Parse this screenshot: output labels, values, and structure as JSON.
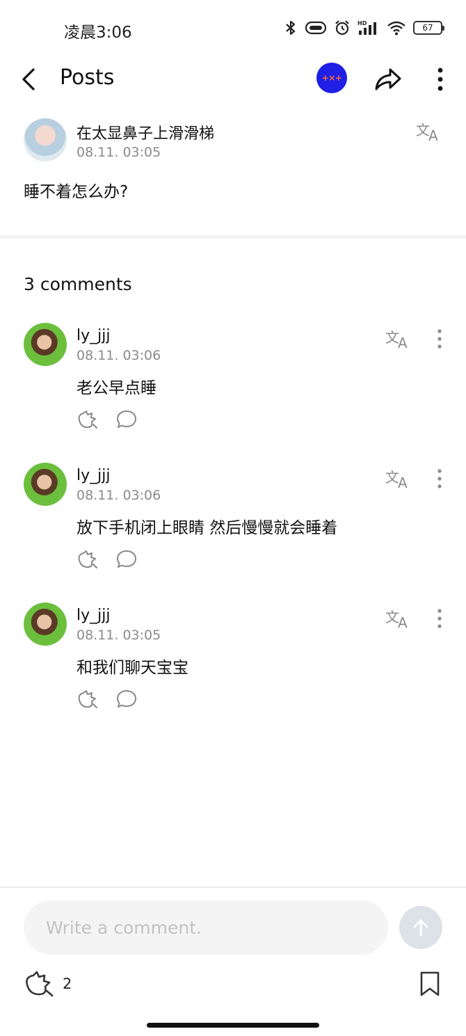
{
  "status_bar": {
    "time": "凌晨3:06",
    "battery": "67"
  },
  "header": {
    "title": "Posts",
    "badge_text": "+×+"
  },
  "post": {
    "author": "在太显鼻子上滑滑梯",
    "time": "08.11. 03:05",
    "body": "睡不着怎么办?"
  },
  "comments_section": {
    "count_label": "3 comments",
    "items": [
      {
        "author": "ly_jjj",
        "time": "08.11. 03:06",
        "text": "老公早点睡"
      },
      {
        "author": "ly_jjj",
        "time": "08.11. 03:06",
        "text": "放下手机闭上眼睛 然后慢慢就会睡着"
      },
      {
        "author": "ly_jjj",
        "time": "08.11. 03:05",
        "text": "和我们聊天宝宝"
      }
    ]
  },
  "composer": {
    "placeholder": "Write a comment."
  },
  "footer": {
    "like_count": "2"
  },
  "colors": {
    "badge_bg": "#1f1fe6",
    "badge_text": "#ff6b3d",
    "send_btn_bg": "#dde1e8",
    "meta_text": "#8a8a8a"
  },
  "icons": {
    "back": "chevron-left-icon",
    "share": "share-arrow-icon",
    "more": "vertical-dots-icon",
    "translate": "translate-icon",
    "like": "cheer-icon",
    "reply": "speech-bubble-icon",
    "send": "arrow-up-icon",
    "bookmark": "bookmark-icon"
  }
}
